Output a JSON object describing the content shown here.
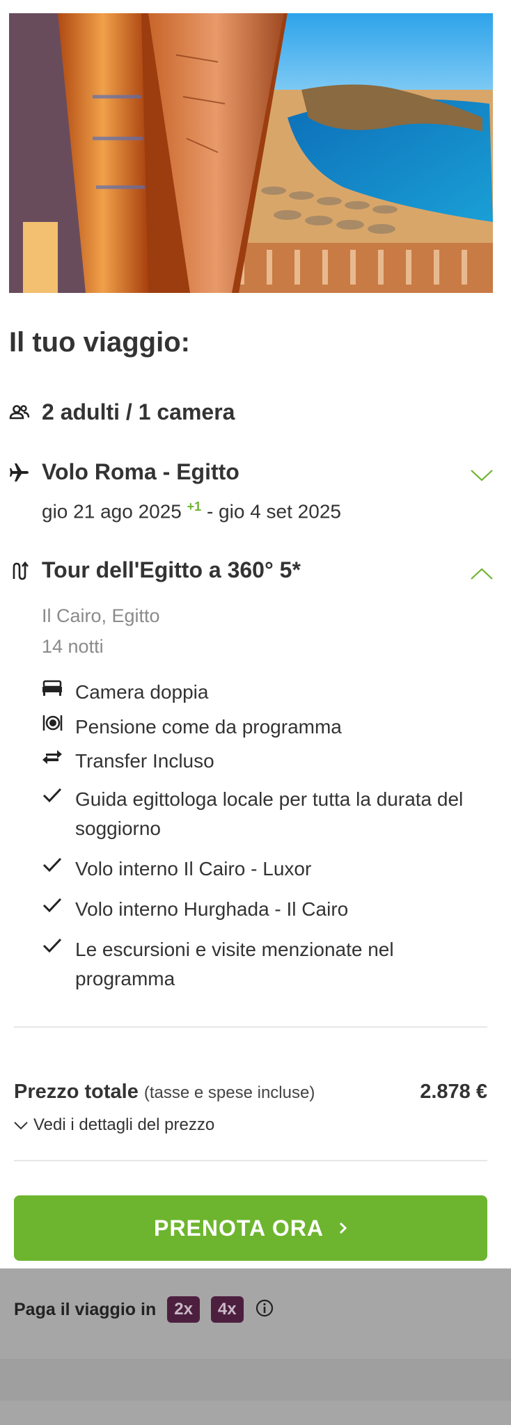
{
  "page": {
    "heading": "Il tuo viaggio:"
  },
  "travelers": {
    "label": "2 adulti / 1 camera",
    "icon": "people-icon"
  },
  "flight": {
    "title": "Volo Roma - Egitto",
    "depart": "gio 21 ago 2025",
    "plus_days": "+1",
    "return": "- gio 4 set 2025",
    "icon": "airplane-icon",
    "expanded": false
  },
  "tour": {
    "title": "Tour dell'Egitto a 360° 5*",
    "location": "Il Cairo, Egitto",
    "nights": "14 notti",
    "icon": "route-icon",
    "expanded": true,
    "features": [
      {
        "icon": "bed-icon",
        "text": "Camera doppia"
      },
      {
        "icon": "dining-icon",
        "text": "Pensione come da programma"
      },
      {
        "icon": "transfer-icon",
        "text": "Transfer Incluso"
      },
      {
        "icon": "check-icon",
        "text": "Guida egittologa locale per tutta la durata del soggiorno"
      },
      {
        "icon": "check-icon",
        "text": "Volo interno Il Cairo - Luxor"
      },
      {
        "icon": "check-icon",
        "text": "Volo interno Hurghada - Il Cairo"
      },
      {
        "icon": "check-icon",
        "text": "Le escursioni e visite menzionate nel programma"
      }
    ]
  },
  "price": {
    "label": "Prezzo totale",
    "note": "(tasse e spese incluse)",
    "amount": "2.878 €",
    "details_link": "Vedi i dettagli del prezzo"
  },
  "cta": {
    "label": "PRENOTA ORA"
  },
  "installments": {
    "label": "Paga il viaggio in",
    "options": [
      "2x",
      "4x"
    ]
  },
  "colors": {
    "accent": "#6db52e",
    "badge": "#4d1f3f",
    "overlay": "#a6a6a6"
  }
}
